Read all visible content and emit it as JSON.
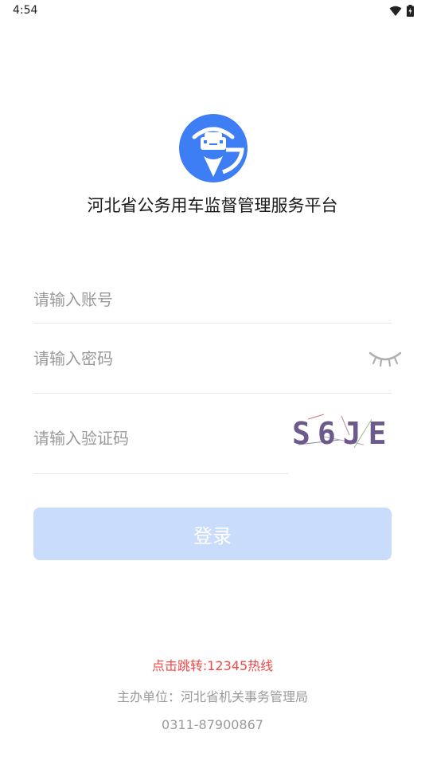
{
  "status_bar": {
    "time": "4:54",
    "wifi_icon": "wifi-icon",
    "battery_icon": "battery-charging-icon"
  },
  "logo": {
    "icon": "car-location-logo",
    "color": "#3d7ef5"
  },
  "app": {
    "title": "河北省公务用车监督管理服务平台"
  },
  "login": {
    "account_placeholder": "请输入账号",
    "password_placeholder": "请输入密码",
    "password_toggle_icon": "eye-closed-icon",
    "captcha_placeholder": "请输入验证码",
    "captcha_code": "S6JE",
    "button_label": "登录",
    "button_color": "#c9dcfc"
  },
  "footer": {
    "hotline": "点击跳转:12345热线",
    "org": "主办单位：河北省机关事务管理局",
    "phone": "0311-87900867",
    "hotline_color": "#f04848"
  }
}
